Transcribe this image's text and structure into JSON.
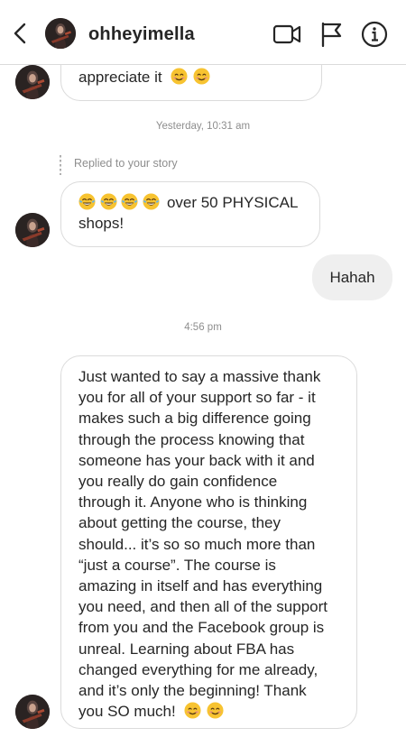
{
  "header": {
    "username": "ohheyimella",
    "icons": [
      "back-chevron-icon",
      "video-camera-icon",
      "flag-icon",
      "info-icon"
    ]
  },
  "messages": {
    "top_partial": {
      "text": "appreciate it",
      "emojis": [
        "smiling-face",
        "smiling-face"
      ]
    },
    "timestamp_1": "Yesterday, 10:31 am",
    "story_reply_note": "Replied to your story",
    "story_reply": {
      "emojis": [
        "tears-of-joy",
        "tears-of-joy",
        "tears-of-joy",
        "tears-of-joy"
      ],
      "text_line1": "over 50 PHYSICAL",
      "text_line2": "shops!"
    },
    "outgoing": {
      "text": "Hahah"
    },
    "timestamp_2": "4:56 pm",
    "long_message": {
      "lines": [
        "Just wanted to say a massive thank",
        "you for all of your support so far - it",
        "makes such a big difference going",
        "through the process knowing that",
        "someone has your back with it and",
        "you really do gain confidence",
        "through it. Anyone who is thinking",
        "about getting the course, they",
        "should... it’s so so much more than",
        "“just a course”. The course is",
        "amazing in itself and has everything",
        "you need, and then all of the support",
        "from you and the Facebook group is",
        "unreal. Learning about FBA has",
        "changed everything for me already,",
        "and it’s only the beginning! Thank"
      ],
      "last_line": "you SO much!",
      "emojis": [
        "smiling-face",
        "smiling-face"
      ]
    }
  },
  "colors": {
    "bubble_border": "#dbdbdb",
    "outgoing_bubble": "#efefef",
    "timestamp_text": "#8e8e8e",
    "emoji_yellow": "#f7c331"
  }
}
